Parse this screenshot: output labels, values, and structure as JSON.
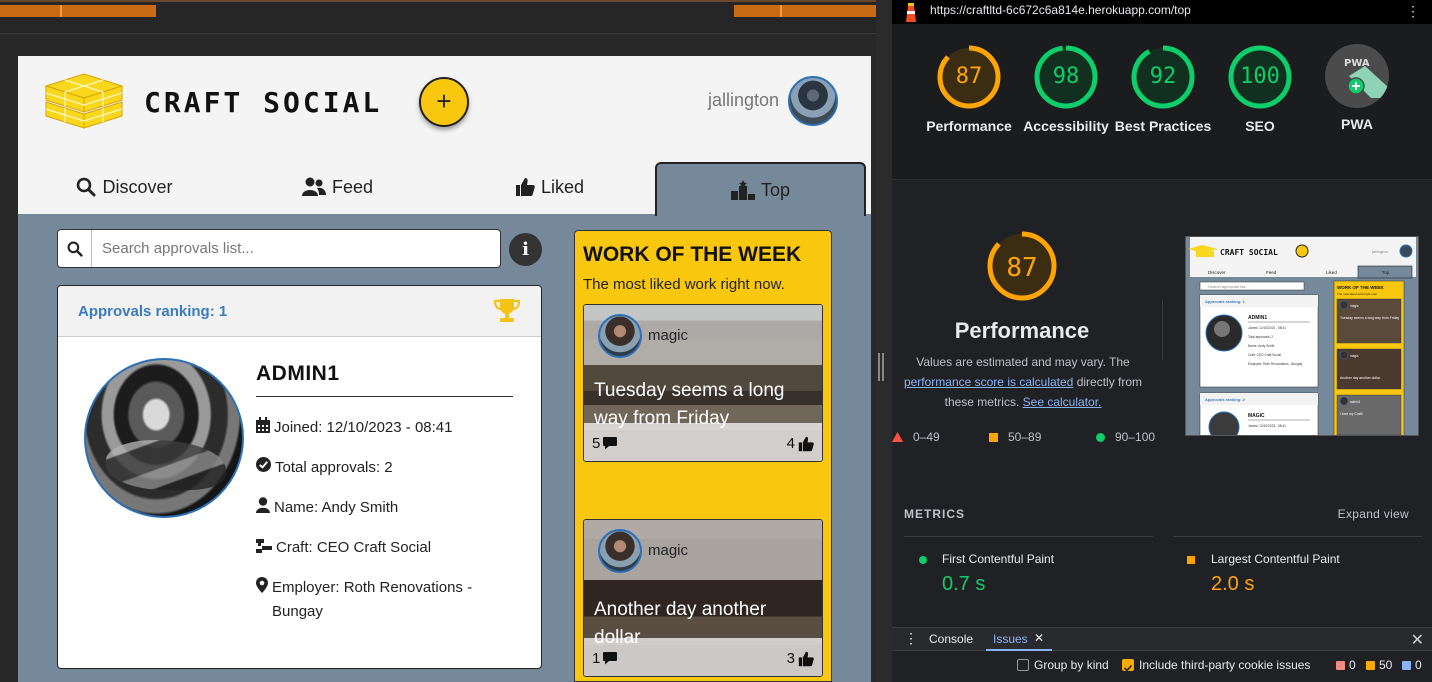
{
  "app": {
    "brand": "CRAFT SOCIAL",
    "add_button": "+",
    "username": "jallington",
    "tabs": [
      {
        "label": "Discover",
        "icon": "search-icon"
      },
      {
        "label": "Feed",
        "icon": "users-icon"
      },
      {
        "label": "Liked",
        "icon": "thumbs-up-icon"
      },
      {
        "label": "Top",
        "icon": "ranking-icon"
      }
    ],
    "active_tab": "Top",
    "search": {
      "placeholder": "Search approvals list..."
    },
    "info_button": "i",
    "ranking_card": {
      "ranking_label": "Approvals ranking: 1",
      "name": "ADMIN1",
      "joined": "Joined: 12/10/2023 - 08:41",
      "total_approvals": "Total approvals: 2",
      "person_name": "Name: Andy Smith",
      "craft": "Craft: CEO Craft Social",
      "employer": "Employer: Roth Renovations - Bungay"
    },
    "work_of_week": {
      "title": "WORK OF THE WEEK",
      "subtitle": "The most liked work right now.",
      "posts": [
        {
          "user": "magic",
          "caption": "Tuesday seems a long way from Friday",
          "comments": "5",
          "likes": "4"
        },
        {
          "user": "magic",
          "caption": "Another day another dollar",
          "comments": "1",
          "likes": "3"
        }
      ]
    },
    "colors": {
      "accent": "#f9c80e",
      "tab_bg": "#75899a",
      "link": "#3a7cbf"
    }
  },
  "devtools": {
    "url": "https://craftltd-6c672c6a814e.herokuapp.com/top",
    "scores": [
      {
        "label": "Performance",
        "value": "87",
        "score": 0.87,
        "color": "#ffa400"
      },
      {
        "label": "Accessibility",
        "value": "98",
        "score": 0.98,
        "color": "#0cce6b"
      },
      {
        "label": "Best Practices",
        "value": "92",
        "score": 0.92,
        "color": "#0cce6b"
      },
      {
        "label": "SEO",
        "value": "100",
        "score": 1.0,
        "color": "#0cce6b"
      },
      {
        "label": "PWA",
        "value": "PWA",
        "color": "#9e9e9e"
      }
    ],
    "performance": {
      "score": "87",
      "title": "Performance",
      "desc_1": "Values are estimated and may vary. The",
      "desc_link_1": "performance score is calculated",
      "desc_2": "directly from",
      "desc_3": "these metrics.",
      "desc_link_2": "See calculator."
    },
    "legend": [
      {
        "range": "0–49",
        "color": "#ff4e42"
      },
      {
        "range": "50–89",
        "color": "#ffa400"
      },
      {
        "range": "90–100",
        "color": "#0cce6b"
      }
    ],
    "metrics_heading": "METRICS",
    "expand_view": "Expand view",
    "metrics": [
      {
        "name": "First Contentful Paint",
        "value": "0.7 s",
        "color": "#0cce6b"
      },
      {
        "name": "Largest Contentful Paint",
        "value": "2.0 s",
        "color": "#ffa400"
      }
    ],
    "drawer": {
      "tabs": [
        "Console",
        "Issues"
      ],
      "active_tab": "Issues",
      "group_by_kind": "Group by kind",
      "include_third_party": "Include third-party cookie issues",
      "counts": [
        {
          "value": "0",
          "color": "#f28b82"
        },
        {
          "value": "50",
          "color": "#f9ab00"
        },
        {
          "value": "0",
          "color": "#8ab4f8"
        }
      ]
    },
    "thumbnail": {
      "brand": "CRAFT SOCIAL",
      "username": "jallington",
      "tabs": [
        "Discover",
        "Feed",
        "Liked",
        "Top"
      ],
      "search_placeholder": "Search approvals list...",
      "ranking_1": "Approvals ranking: 1",
      "name_1": "ADMIN1",
      "details_1": [
        "Joined: 12/10/2023 - 08:41",
        "Total approvals: 2",
        "Name: Andy Smith",
        "Craft: CEO Craft Social",
        "Employer: Roth Renovations - Bungay"
      ],
      "ranking_2": "Approvals ranking: 2",
      "name_2": "MAGIC",
      "details_2": [
        "Joined: 12/10/2023 - 08:41"
      ],
      "wotw_title": "WORK OF THE WEEK",
      "wotw_sub": "The most liked work right now.",
      "posts": [
        {
          "user": "magic",
          "caption": "Tuesday seems a long way from Friday"
        },
        {
          "user": "magic",
          "caption": "Another day another dollar"
        },
        {
          "user": "admin1",
          "caption": "I love my Craft!"
        }
      ]
    }
  }
}
